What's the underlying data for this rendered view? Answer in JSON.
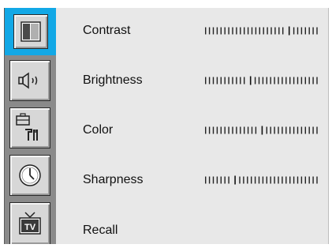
{
  "sidebar": {
    "items": [
      {
        "icon": "picture-icon",
        "active": true
      },
      {
        "icon": "speaker-icon",
        "active": false
      },
      {
        "icon": "tools-icon",
        "active": false
      },
      {
        "icon": "clock-icon",
        "active": false
      },
      {
        "icon": "tv-icon",
        "active": false,
        "label": "TV"
      }
    ]
  },
  "menu": {
    "items": [
      {
        "label": "Contrast",
        "value": 0.75
      },
      {
        "label": "Brightness",
        "value": 0.4
      },
      {
        "label": "Color",
        "value": 0.5
      },
      {
        "label": "Sharpness",
        "value": 0.25
      },
      {
        "label": "Recall"
      }
    ]
  },
  "colors": {
    "accent": "#12a8e6",
    "panel": "#e8e8e8",
    "sidebar": "#8a8a8a"
  }
}
